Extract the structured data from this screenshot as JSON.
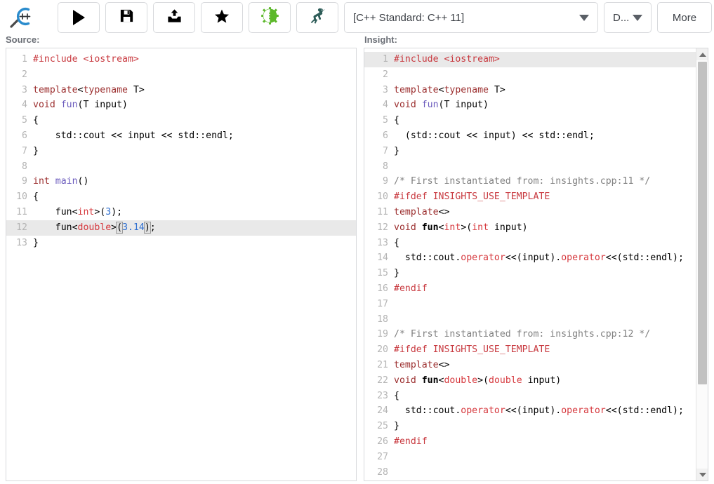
{
  "app": {
    "logo_icon": "cpp-insights-magnifier-logo"
  },
  "toolbar": {
    "buttons": [
      {
        "name": "run-button",
        "icon": "play-icon",
        "label": ""
      },
      {
        "name": "save-button",
        "icon": "floppy-disk-icon",
        "label": ""
      },
      {
        "name": "upload-button",
        "icon": "upload-icon",
        "label": ""
      },
      {
        "name": "favorite-button",
        "icon": "star-icon",
        "label": ""
      },
      {
        "name": "compiler-explorer-button",
        "icon": "green-gear-icon",
        "label": ""
      },
      {
        "name": "quick-bench-button",
        "icon": "ostrich-icon",
        "label": ""
      }
    ],
    "standard_select": {
      "value": "[C++ Standard: C++ 11]",
      "caret_icon": "chevron-down-icon"
    },
    "options_select": {
      "value": "D...",
      "caret_icon": "chevron-down-icon"
    },
    "more_button": {
      "label": "More"
    }
  },
  "panels": {
    "source_label": "Source:",
    "insight_label": "Insight:"
  },
  "source_editor": {
    "active_line": 12,
    "lines": [
      {
        "n": "1",
        "tokens": [
          {
            "t": "#include ",
            "c": "s-pre"
          },
          {
            "t": "<iostream>",
            "c": "s-str"
          }
        ]
      },
      {
        "n": "2",
        "tokens": [
          {
            "t": "",
            "c": ""
          }
        ]
      },
      {
        "n": "3",
        "tokens": [
          {
            "t": "template",
            "c": "s-kw"
          },
          {
            "t": "<",
            "c": ""
          },
          {
            "t": "typename",
            "c": "s-kw"
          },
          {
            "t": " T>",
            "c": ""
          }
        ]
      },
      {
        "n": "4",
        "tokens": [
          {
            "t": "void ",
            "c": "s-kw"
          },
          {
            "t": "fun",
            "c": "s-fn"
          },
          {
            "t": "(T input)",
            "c": ""
          }
        ]
      },
      {
        "n": "5",
        "tokens": [
          {
            "t": "{",
            "c": ""
          }
        ]
      },
      {
        "n": "6",
        "tokens": [
          {
            "t": "    std::cout << input << std::endl;",
            "c": ""
          }
        ]
      },
      {
        "n": "7",
        "tokens": [
          {
            "t": "}",
            "c": ""
          }
        ]
      },
      {
        "n": "8",
        "tokens": [
          {
            "t": "",
            "c": ""
          }
        ]
      },
      {
        "n": "9",
        "tokens": [
          {
            "t": "int ",
            "c": "s-kw"
          },
          {
            "t": "main",
            "c": "s-fn"
          },
          {
            "t": "()",
            "c": ""
          }
        ]
      },
      {
        "n": "10",
        "tokens": [
          {
            "t": "{",
            "c": ""
          }
        ]
      },
      {
        "n": "11",
        "tokens": [
          {
            "t": "    fun<",
            "c": ""
          },
          {
            "t": "int",
            "c": "s-type"
          },
          {
            "t": ">(",
            "c": ""
          },
          {
            "t": "3",
            "c": "s-num"
          },
          {
            "t": ");",
            "c": ""
          }
        ]
      },
      {
        "n": "12",
        "tokens": [
          {
            "t": "    fun<",
            "c": ""
          },
          {
            "t": "double",
            "c": "s-type"
          },
          {
            "t": ">",
            "c": ""
          },
          {
            "t": "(",
            "c": "brk"
          },
          {
            "t": "3.14",
            "c": "s-num"
          },
          {
            "t": ")",
            "c": "brk"
          },
          {
            "t": ";",
            "c": ""
          }
        ]
      },
      {
        "n": "13",
        "tokens": [
          {
            "t": "}",
            "c": ""
          }
        ]
      }
    ]
  },
  "insight_editor": {
    "active_line": 1,
    "scrollbar": {
      "up_icon": "triangle-up-icon",
      "down_icon": "triangle-down-icon"
    },
    "lines": [
      {
        "n": "1",
        "tokens": [
          {
            "t": "#include ",
            "c": "s-pre"
          },
          {
            "t": "<iostream>",
            "c": "s-str"
          }
        ]
      },
      {
        "n": "2",
        "tokens": [
          {
            "t": "",
            "c": ""
          }
        ]
      },
      {
        "n": "3",
        "tokens": [
          {
            "t": "template",
            "c": "s-kw"
          },
          {
            "t": "<",
            "c": ""
          },
          {
            "t": "typename",
            "c": "s-kw"
          },
          {
            "t": " T>",
            "c": ""
          }
        ]
      },
      {
        "n": "4",
        "tokens": [
          {
            "t": "void ",
            "c": "s-kw"
          },
          {
            "t": "fun",
            "c": "s-fn"
          },
          {
            "t": "(T input)",
            "c": ""
          }
        ]
      },
      {
        "n": "5",
        "tokens": [
          {
            "t": "{",
            "c": ""
          }
        ]
      },
      {
        "n": "6",
        "tokens": [
          {
            "t": "  (std::cout << input) << std::endl;",
            "c": ""
          }
        ]
      },
      {
        "n": "7",
        "tokens": [
          {
            "t": "}",
            "c": ""
          }
        ]
      },
      {
        "n": "8",
        "tokens": [
          {
            "t": "",
            "c": ""
          }
        ]
      },
      {
        "n": "9",
        "tokens": [
          {
            "t": "/* First instantiated from: insights.cpp:11 */",
            "c": "s-cmt"
          }
        ]
      },
      {
        "n": "10",
        "tokens": [
          {
            "t": "#ifdef INSIGHTS_USE_TEMPLATE",
            "c": "s-pre"
          }
        ]
      },
      {
        "n": "11",
        "tokens": [
          {
            "t": "template",
            "c": "s-kw"
          },
          {
            "t": "<>",
            "c": ""
          }
        ]
      },
      {
        "n": "12",
        "tokens": [
          {
            "t": "void ",
            "c": "s-kw"
          },
          {
            "t": "fun",
            "c": "s-bold"
          },
          {
            "t": "<",
            "c": ""
          },
          {
            "t": "int",
            "c": "s-type"
          },
          {
            "t": ">(",
            "c": ""
          },
          {
            "t": "int",
            "c": "s-type"
          },
          {
            "t": " input)",
            "c": ""
          }
        ]
      },
      {
        "n": "13",
        "tokens": [
          {
            "t": "{",
            "c": ""
          }
        ]
      },
      {
        "n": "14",
        "tokens": [
          {
            "t": "  std::cout.",
            "c": ""
          },
          {
            "t": "operator",
            "c": "s-op"
          },
          {
            "t": "<<(input).",
            "c": ""
          },
          {
            "t": "operator",
            "c": "s-op"
          },
          {
            "t": "<<(std::endl);",
            "c": ""
          }
        ]
      },
      {
        "n": "15",
        "tokens": [
          {
            "t": "}",
            "c": ""
          }
        ]
      },
      {
        "n": "16",
        "tokens": [
          {
            "t": "#endif",
            "c": "s-pre"
          }
        ]
      },
      {
        "n": "17",
        "tokens": [
          {
            "t": "",
            "c": ""
          }
        ]
      },
      {
        "n": "18",
        "tokens": [
          {
            "t": "",
            "c": ""
          }
        ]
      },
      {
        "n": "19",
        "tokens": [
          {
            "t": "/* First instantiated from: insights.cpp:12 */",
            "c": "s-cmt"
          }
        ]
      },
      {
        "n": "20",
        "tokens": [
          {
            "t": "#ifdef INSIGHTS_USE_TEMPLATE",
            "c": "s-pre"
          }
        ]
      },
      {
        "n": "21",
        "tokens": [
          {
            "t": "template",
            "c": "s-kw"
          },
          {
            "t": "<>",
            "c": ""
          }
        ]
      },
      {
        "n": "22",
        "tokens": [
          {
            "t": "void ",
            "c": "s-kw"
          },
          {
            "t": "fun",
            "c": "s-bold"
          },
          {
            "t": "<",
            "c": ""
          },
          {
            "t": "double",
            "c": "s-type"
          },
          {
            "t": ">(",
            "c": ""
          },
          {
            "t": "double",
            "c": "s-type"
          },
          {
            "t": " input)",
            "c": ""
          }
        ]
      },
      {
        "n": "23",
        "tokens": [
          {
            "t": "{",
            "c": ""
          }
        ]
      },
      {
        "n": "24",
        "tokens": [
          {
            "t": "  std::cout.",
            "c": ""
          },
          {
            "t": "operator",
            "c": "s-op"
          },
          {
            "t": "<<(input).",
            "c": ""
          },
          {
            "t": "operator",
            "c": "s-op"
          },
          {
            "t": "<<(std::endl);",
            "c": ""
          }
        ]
      },
      {
        "n": "25",
        "tokens": [
          {
            "t": "}",
            "c": ""
          }
        ]
      },
      {
        "n": "26",
        "tokens": [
          {
            "t": "#endif",
            "c": "s-pre"
          }
        ]
      },
      {
        "n": "27",
        "tokens": [
          {
            "t": "",
            "c": ""
          }
        ]
      },
      {
        "n": "28",
        "tokens": [
          {
            "t": "",
            "c": ""
          }
        ]
      }
    ]
  },
  "colors": {
    "preprocessor": "#c8393f",
    "keyword": "#9b2d2d",
    "type": "#d6383d",
    "function": "#6b5bbd",
    "number": "#2f6fd0",
    "comment": "#808080",
    "active_line": "#e9e9e9",
    "logo_blue": "#2b8ccd",
    "gear_green": "#5cb82b",
    "bird_teal": "#2d5c58"
  }
}
